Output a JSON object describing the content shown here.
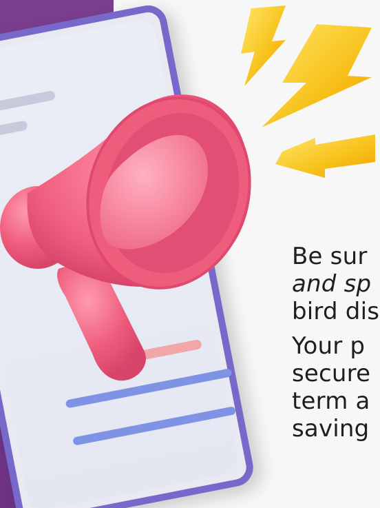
{
  "illustration": {
    "purple_bg": "#7b3f8f",
    "phone_frame": "#7669c9",
    "megaphone_color": "#ef5d7d",
    "bolt_color": "#f7c11a"
  },
  "text": {
    "p1_line1": "Be sur",
    "p1_line2": "and sp",
    "p1_line3": "bird dis",
    "p2_line1": "Your p",
    "p2_line2": "secure",
    "p2_line3": "term a",
    "p2_line4": "saving"
  }
}
